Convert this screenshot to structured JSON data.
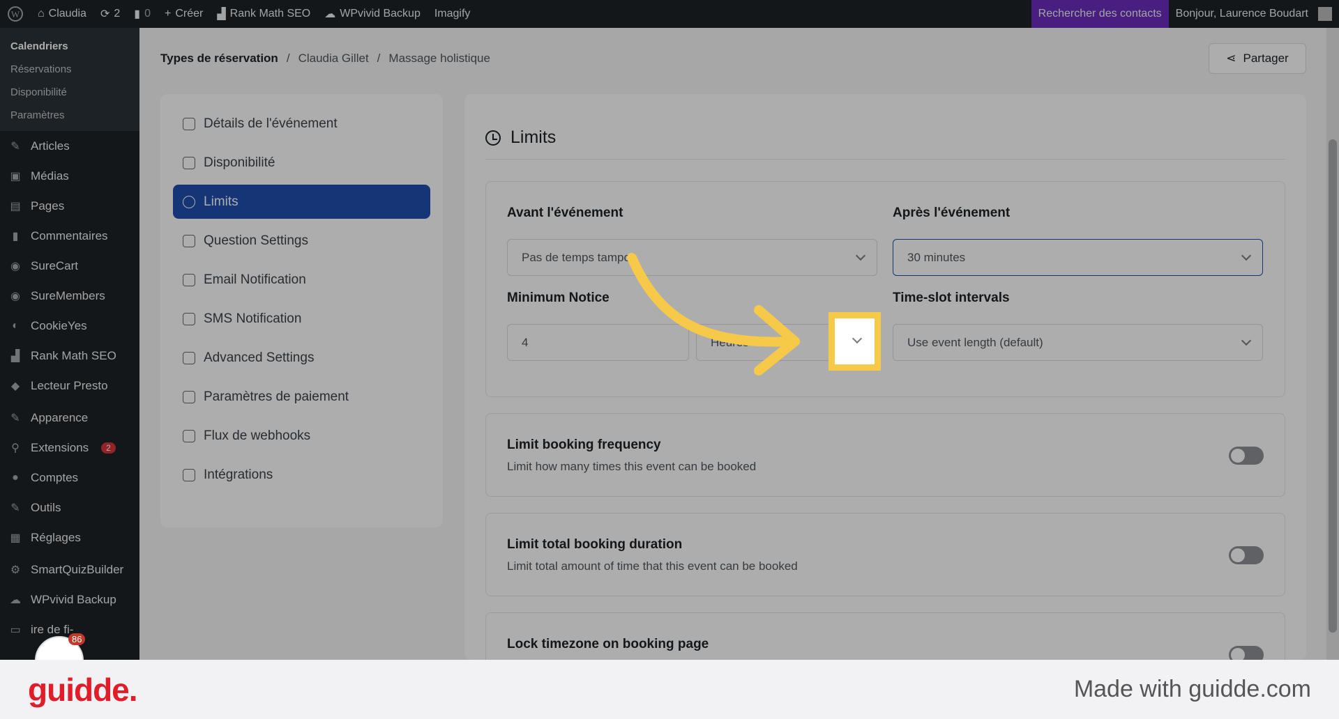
{
  "admin_bar": {
    "site": "Claudia",
    "updates": "2",
    "comments": "0",
    "create": "Créer",
    "rank_math": "Rank Math SEO",
    "wpvivid": "WPvivid Backup",
    "imagify": "Imagify",
    "search_contacts": "Rechercher des contacts",
    "greeting": "Bonjour, Laurence Boudart"
  },
  "sidebar": {
    "submenu": [
      "Calendriers",
      "Réservations",
      "Disponibilité",
      "Paramètres"
    ],
    "items": [
      {
        "label": "Articles",
        "icon": "pin-icon"
      },
      {
        "label": "Médias",
        "icon": "media-icon"
      },
      {
        "label": "Pages",
        "icon": "page-icon"
      },
      {
        "label": "Commentaires",
        "icon": "comment-icon"
      },
      {
        "label": "SureCart",
        "icon": "surecart-icon"
      },
      {
        "label": "SureMembers",
        "icon": "suremembers-icon"
      },
      {
        "label": "CookieYes",
        "icon": "cookie-icon"
      },
      {
        "label": "Rank Math SEO",
        "icon": "chart-icon"
      },
      {
        "label": "Lecteur Presto",
        "icon": "presto-icon"
      },
      {
        "label": "Apparence",
        "icon": "brush-icon"
      },
      {
        "label": "Extensions",
        "icon": "plugin-icon",
        "badge": "2"
      },
      {
        "label": "Comptes",
        "icon": "user-icon"
      },
      {
        "label": "Outils",
        "icon": "wrench-icon"
      },
      {
        "label": "Réglages",
        "icon": "settings-icon"
      },
      {
        "label": "SmartQuizBuilder",
        "icon": "gear-icon"
      },
      {
        "label": "WPvivid Backup",
        "icon": "cloud-icon"
      },
      {
        "label": "ire de fi-",
        "icon": "folder-icon"
      }
    ]
  },
  "breadcrumb": {
    "root": "Types de réservation",
    "middle": "Claudia Gillet",
    "current": "Massage holistique",
    "sep": "/"
  },
  "share_label": "Partager",
  "nav": [
    "Détails de l'événement",
    "Disponibilité",
    "Limits",
    "Question Settings",
    "Email Notification",
    "SMS Notification",
    "Advanced Settings",
    "Paramètres de paiement",
    "Flux de webhooks",
    "Intégrations"
  ],
  "section_title": "Limits",
  "form": {
    "before_label": "Avant l'événement",
    "before_value": "Pas de temps tampon",
    "after_label": "Après l'événement",
    "after_value": "30 minutes",
    "notice_label": "Minimum Notice",
    "notice_value": "4",
    "notice_unit": "Heures",
    "interval_label": "Time-slot intervals",
    "interval_value": "Use event length (default)"
  },
  "options": [
    {
      "title": "Limit booking frequency",
      "desc": "Limit how many times this event can be booked",
      "on": false
    },
    {
      "title": "Limit total booking duration",
      "desc": "Limit total amount of time that this event can be booked",
      "on": false
    },
    {
      "title": "Lock timezone on booking page",
      "desc": "",
      "on": false
    }
  ],
  "avatar_badge": "86",
  "footer": {
    "brand": "guidde.",
    "made_with": "Made with guidde.com"
  },
  "colors": {
    "accent": "#1f4fae",
    "highlight": "#f7c948",
    "brand": "#e11d2a"
  }
}
